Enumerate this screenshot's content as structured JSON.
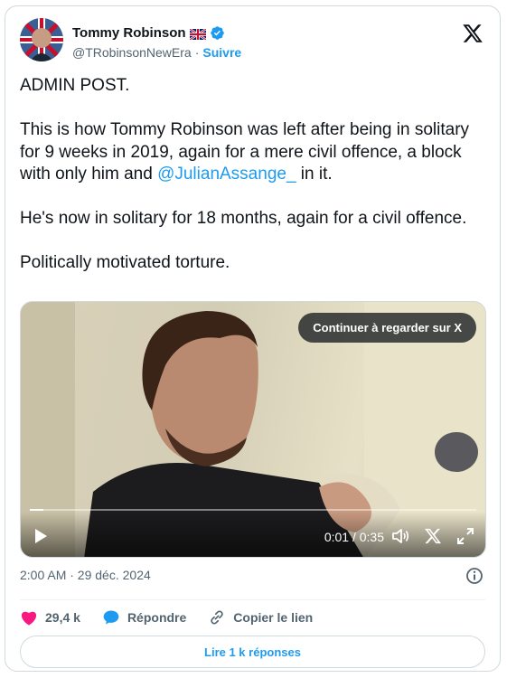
{
  "author": {
    "name": "Tommy Robinson",
    "handle": "@TRobinsonNewEra",
    "separator": "·",
    "follow_label": "Suivre"
  },
  "tweet": {
    "paragraphs": [
      "ADMIN POST.",
      {
        "before": "This is how Tommy Robinson was left after being in solitary for 9 weeks in 2019, again for a mere civil offence, a block with only him and ",
        "mention": "@JulianAssange_",
        "after": " in it."
      },
      "He's now in solitary for 18 months, again for a civil offence.",
      "Politically motivated torture."
    ]
  },
  "video": {
    "continue_label": "Continuer à regarder sur X",
    "time_label": "0:01 / 0:35",
    "progress": 0.03
  },
  "meta": {
    "timestamp": "2:00 AM · 29 déc. 2024"
  },
  "actions": {
    "likes": "29,4 k",
    "reply_label": "Répondre",
    "copy_label": "Copier le lien"
  },
  "replies_button": "Lire 1 k réponses",
  "icons": {
    "flag": "uk-flag-icon",
    "verified": "verified-badge-icon",
    "logo": "x-logo-icon",
    "info": "info-icon",
    "like": "heart-icon",
    "reply": "speech-bubble-icon",
    "copy": "link-icon"
  },
  "colors": {
    "accent": "#1d9bf0",
    "like": "#f91880",
    "text": "#0f1419",
    "muted": "#536471"
  }
}
